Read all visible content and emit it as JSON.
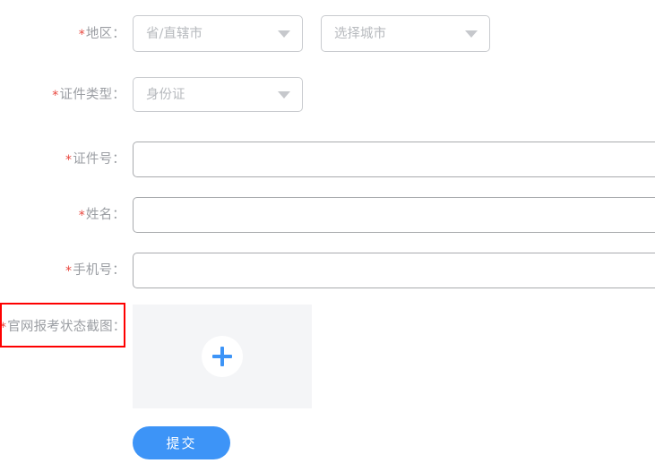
{
  "form": {
    "fields": [
      {
        "id": "region",
        "label": "地区：",
        "required_marker": "*",
        "type": "select-pair",
        "province_placeholder": "省/直辖市",
        "city_placeholder": "选择城市",
        "caret_icon": "chevron-down-icon"
      },
      {
        "id": "id-type",
        "label": "证件类型：",
        "required_marker": "*",
        "type": "select",
        "value": "身份证",
        "caret_icon": "chevron-down-icon"
      },
      {
        "id": "id-number",
        "label": "证件号：",
        "required_marker": "*",
        "type": "text",
        "value": "",
        "placeholder": ""
      },
      {
        "id": "name",
        "label": "姓名：",
        "required_marker": "*",
        "type": "text",
        "value": "",
        "placeholder": ""
      },
      {
        "id": "phone",
        "label": "手机号：",
        "required_marker": "*",
        "type": "text",
        "value": "",
        "placeholder": ""
      },
      {
        "id": "screenshot",
        "label": "官网报考状态截图：",
        "required_marker": "*",
        "type": "image-upload",
        "upload_icon": "plus-icon"
      }
    ],
    "submit_label": "提交"
  },
  "colors": {
    "accent": "#3d94f7",
    "required_star": "#e8453c",
    "label_text": "#9b9ea3",
    "placeholder_text": "#b7babe",
    "input_border": "#a9abae",
    "select_border": "#c9cbcf",
    "upload_background": "#f4f5f7",
    "annotation_border": "#fe0000"
  }
}
